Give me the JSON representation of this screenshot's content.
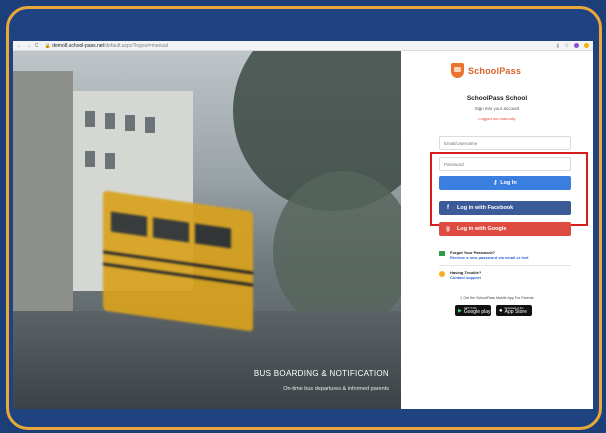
{
  "browser": {
    "url_host": "demo8.school-pass.net",
    "url_path": "/default.aspx?logout=manual",
    "back": "←",
    "forward": "→",
    "reload": "C"
  },
  "hero": {
    "title": "BUS BOARDING & NOTIFICATION",
    "subtitle": "On-time bus departures & informed parents"
  },
  "brand": {
    "name": "SchoolPass"
  },
  "login": {
    "school_name": "SchoolPass School",
    "signin_text": "Sign into your account",
    "logged_out_text": "Logged out manually",
    "email_placeholder": "Email/Username",
    "password_placeholder": "Password",
    "login_label": "Log In",
    "facebook_label": "Log in with Facebook",
    "google_label": "Log in with Google"
  },
  "help": {
    "forgot_title": "Forgot Your Password?",
    "forgot_link": "Recieve a new password via email or text",
    "trouble_title": "Having Trouble?",
    "trouble_link": "Contact support"
  },
  "mobile": {
    "text": "Get the SchoolPass Mobile App For Parents",
    "google_small": "GET IT ON",
    "google_big": "Google play",
    "apple_small": "Download on the",
    "apple_big": "App Store"
  },
  "colors": {
    "frame_border": "#e9a93a",
    "background": "#1e4380",
    "login_button": "#3a7ee0",
    "facebook": "#3b5b98",
    "google": "#de4b41",
    "highlight": "#d51e1e",
    "brand": "#d9612a"
  }
}
